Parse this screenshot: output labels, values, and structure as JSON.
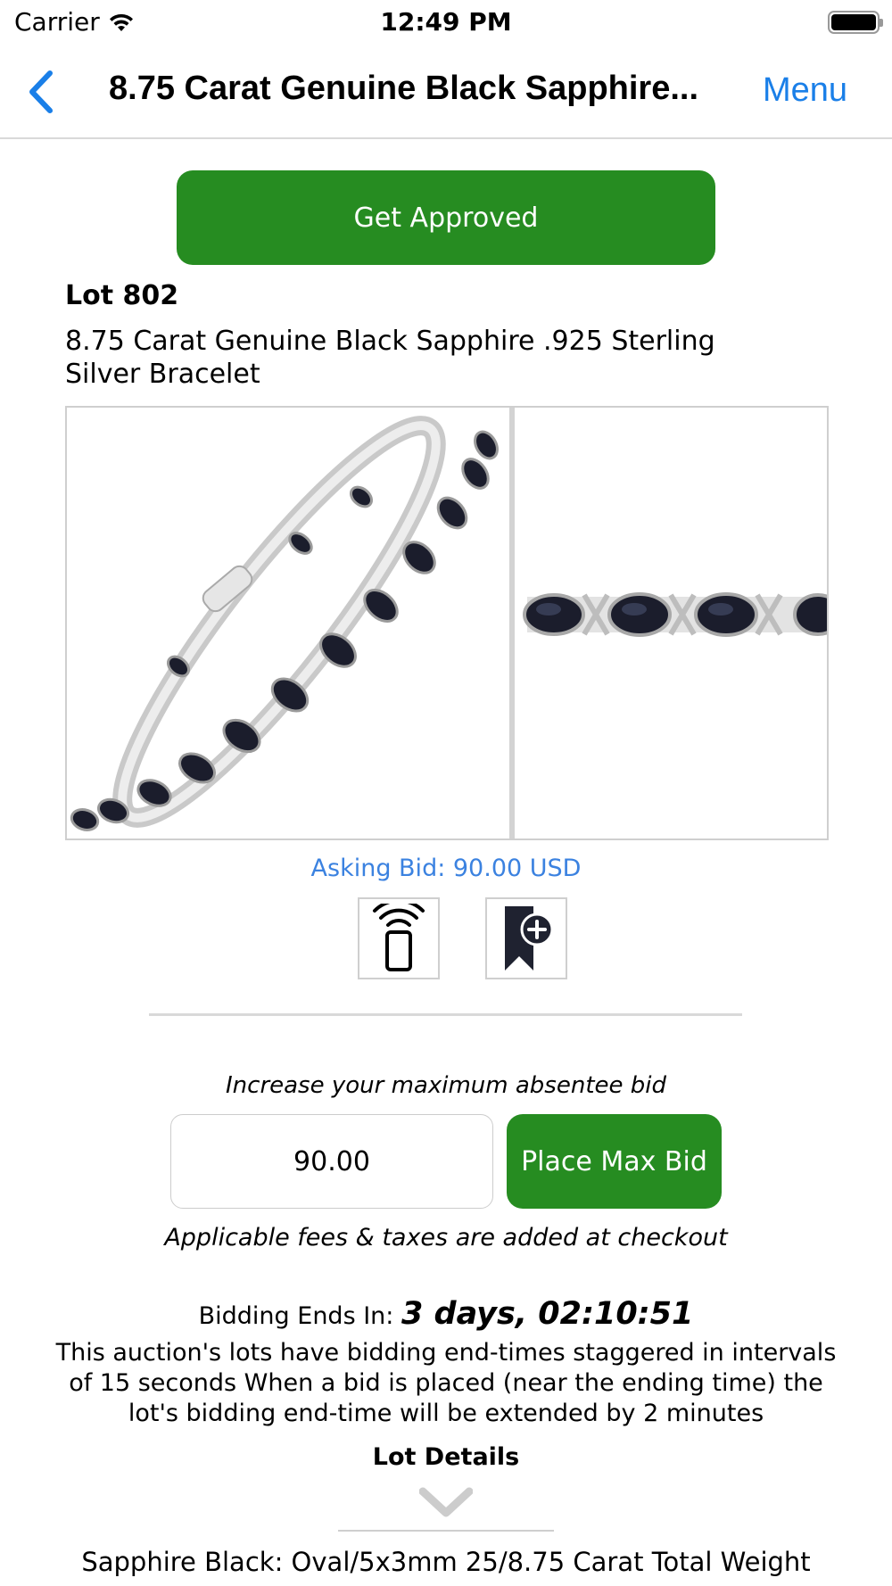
{
  "status_bar": {
    "carrier": "Carrier",
    "time": "12:49 PM",
    "wifi_icon": "wifi-icon",
    "battery_icon": "battery-icon",
    "battery_level": 1.0
  },
  "nav": {
    "back_icon": "chevron-left-icon",
    "title": "8.75 Carat Genuine Black Sapphire...",
    "menu_label": "Menu"
  },
  "get_approved_label": "Get Approved",
  "lot": {
    "number": "Lot 802",
    "title": "8.75 Carat Genuine Black Sapphire .925 Sterling Silver Bracelet"
  },
  "gallery": {
    "images": [
      "bracelet-photo",
      "bracelet-closeup-photo"
    ]
  },
  "asking_bid": "Asking Bid: 90.00 USD",
  "action_icons": [
    "remote-bid-icon",
    "add-to-watchlist-icon"
  ],
  "bid_form": {
    "label": "Increase your maximum absentee bid",
    "value": "90.00",
    "button_label": "Place Max Bid",
    "fees_note": "Applicable fees & taxes are added at checkout"
  },
  "bidding": {
    "ends_label": "Bidding Ends In:",
    "countdown": "3 days, 02:10:51",
    "stagger_note": "This auction's lots have bidding end-times staggered in intervals of 15 seconds When a bid is placed (near the ending time) the lot's bidding end-time will be extended by 2 minutes"
  },
  "lot_details": {
    "heading": "Lot Details",
    "toggle_icon": "chevron-down-icon",
    "first_line": "Sapphire Black: Oval/5x3mm 25/8.75 Carat Total Weight"
  },
  "colors": {
    "accent_green": "#268c21",
    "link_blue": "#1a7fe8",
    "asking_blue": "#3b82e0"
  }
}
